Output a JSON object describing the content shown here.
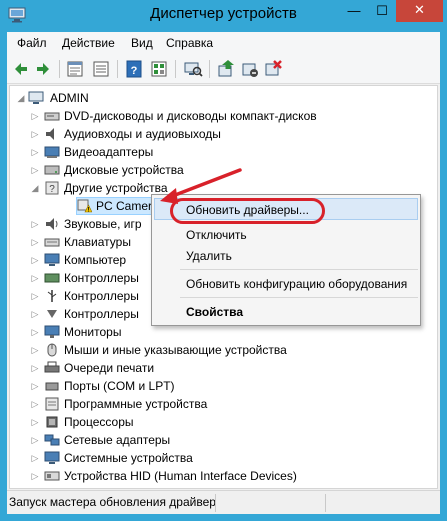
{
  "window": {
    "title": "Диспетчер устройств",
    "minimize_glyph": "—",
    "maximize_glyph": "☐",
    "close_glyph": "✕"
  },
  "menubar": {
    "file": "Файл",
    "action": "Действие",
    "view": "Вид",
    "help": "Справка"
  },
  "toolbar": {
    "buttons": [
      "back-icon",
      "forward-icon",
      "properties-pane-icon",
      "list-view-icon",
      "help-icon",
      "resources-icon",
      "scan-hardware-icon",
      "update-driver-icon",
      "disable-device-icon",
      "uninstall-device-icon"
    ]
  },
  "tree": {
    "root": "ADMIN",
    "categories": [
      "DVD-дисководы и дисководы компакт-дисков",
      "Аудиовходы и аудиовыходы",
      "Видеоадаптеры",
      "Дисковые устройства",
      "Другие устройства",
      "PC Camera",
      "Звуковые, игр",
      "Клавиатуры",
      "Компьютер",
      "Контроллеры",
      "Контроллеры",
      "Контроллеры",
      "Мониторы",
      "Мыши и иные указывающие устройства",
      "Очереди печати",
      "Порты (COM и LPT)",
      "Программные устройства",
      "Процессоры",
      "Сетевые адаптеры",
      "Системные устройства",
      "Устройства HID (Human Interface Devices)"
    ]
  },
  "context_menu": {
    "update_drivers": "Обновить драйверы...",
    "disable": "Отключить",
    "delete": "Удалить",
    "scan_hardware": "Обновить конфигурацию оборудования",
    "properties": "Свойства"
  },
  "statusbar": {
    "text": "Запуск мастера обновления драйвер"
  },
  "colors": {
    "titlebar": "#34a7d6",
    "close_button": "#c7463a",
    "annotation_red": "#d8212a",
    "selection": "#cce8ff"
  }
}
